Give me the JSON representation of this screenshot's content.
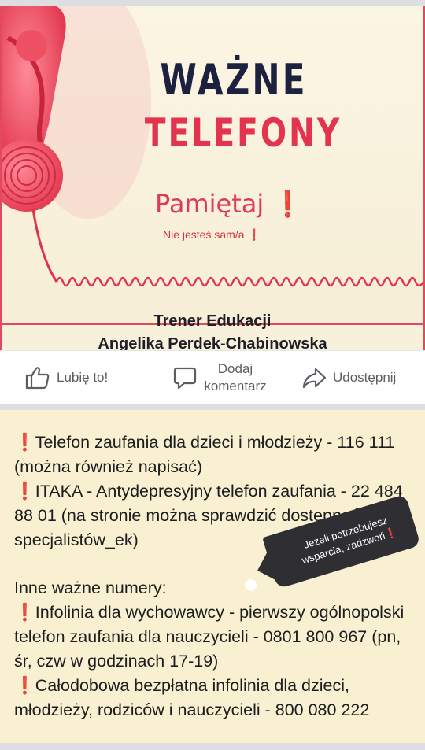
{
  "poster": {
    "headline_line1": "WAŻNE",
    "headline_line2": "TELEFONY",
    "remember": "Pamiętaj",
    "remember_mark": "❗",
    "not_alone": "Nie jesteś sam/a",
    "not_alone_mark": "❗",
    "trainer_title": "Trener Edukacji",
    "trainer_name": "Angelika Perdek-Chabinowska",
    "colors": {
      "navy": "#1d2140",
      "red": "#e2334f",
      "cream": "#f7f0db"
    }
  },
  "actions": {
    "like": {
      "label": "Lubię to!",
      "icon": "thumbs-up-icon"
    },
    "comment": {
      "label_line1": "Dodaj",
      "label_line2": "komentarz",
      "icon": "comment-icon"
    },
    "share": {
      "label": "Udostępnij",
      "icon": "share-icon"
    }
  },
  "post_text": {
    "item1": "Telefon zaufania dla dzieci i młodzieży - 116 111 (można również napisać)",
    "item2": "ITAKA - Antydepresyjny telefon zaufania - 22 484 88 01 (na stronie można sprawdzić dostępność specjalistów_ek)",
    "other_heading": "Inne ważne numery:",
    "item3": "Infolinia dla wychowawcy - pierwszy ogólnopolski telefon zaufania dla nauczycieli - 0801 800 967 (pn, śr, czw w godzinach 17-19)",
    "item4": "Całodobowa bezpłatna infolinia dla dzieci, młodzieży, rodziców i nauczycieli - 800 080 222",
    "bang": "❗"
  },
  "badge": {
    "line1": "Jeżeli potrzebujesz",
    "line2": "wsparcia, zadzwoń",
    "mark": "❗"
  }
}
